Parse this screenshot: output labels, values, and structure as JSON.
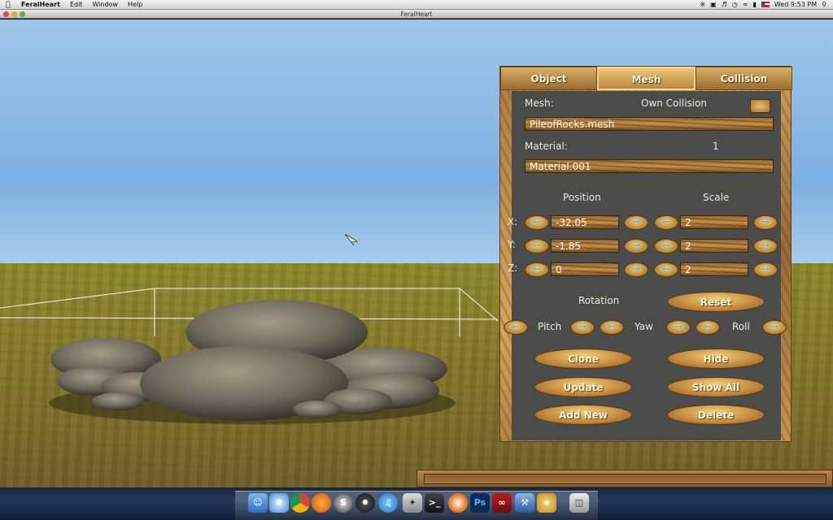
{
  "menubar": {
    "app_name": "FeralHeart",
    "items": [
      "Edit",
      "Window",
      "Help"
    ],
    "clock": "Wed 9:53 PM"
  },
  "window": {
    "title": "FeralHeart"
  },
  "panel": {
    "tabs": [
      "Object",
      "Mesh",
      "Collision"
    ],
    "active_tab": "Mesh",
    "mesh_label": "Mesh:",
    "own_collision_label": "Own  Collision",
    "mesh_value": "PileofRocks.mesh",
    "material_label": "Material:",
    "material_index": "1",
    "material_value": "Material.001",
    "position_label": "Position",
    "scale_label": "Scale",
    "axes": [
      "X:",
      "Y:",
      "Z:"
    ],
    "position": [
      "-32.05",
      "-1.85",
      "0"
    ],
    "scale": [
      "2",
      "2",
      "2"
    ],
    "rotation_label": "Rotation",
    "reset_label": "Reset",
    "pitch_label": "Pitch",
    "yaw_label": "Yaw",
    "roll_label": "Roll",
    "buttons": {
      "clone": "Clone",
      "hide": "Hide",
      "update": "Update",
      "show_all": "Show  All",
      "add_new": "Add  New",
      "delete": "Delete"
    }
  },
  "colors": {
    "sky": "#7db0e1",
    "ground": "#877c2a",
    "wood": "#c5904a",
    "panel_bg": "#4b4b49",
    "arrow_glyph": "#4fb6f0"
  },
  "dock": {
    "icons": [
      "finder-icon",
      "safari-icon",
      "chrome-icon",
      "firefox-icon",
      "steam-icon",
      "unity-icon",
      "itunes-icon",
      "app-icon",
      "terminal-icon",
      "blender-icon",
      "photoshop-icon",
      "acrobat-icon",
      "xcode-icon",
      "feralheart-icon",
      "trash-icon"
    ],
    "photoshop_label": "Ps"
  }
}
